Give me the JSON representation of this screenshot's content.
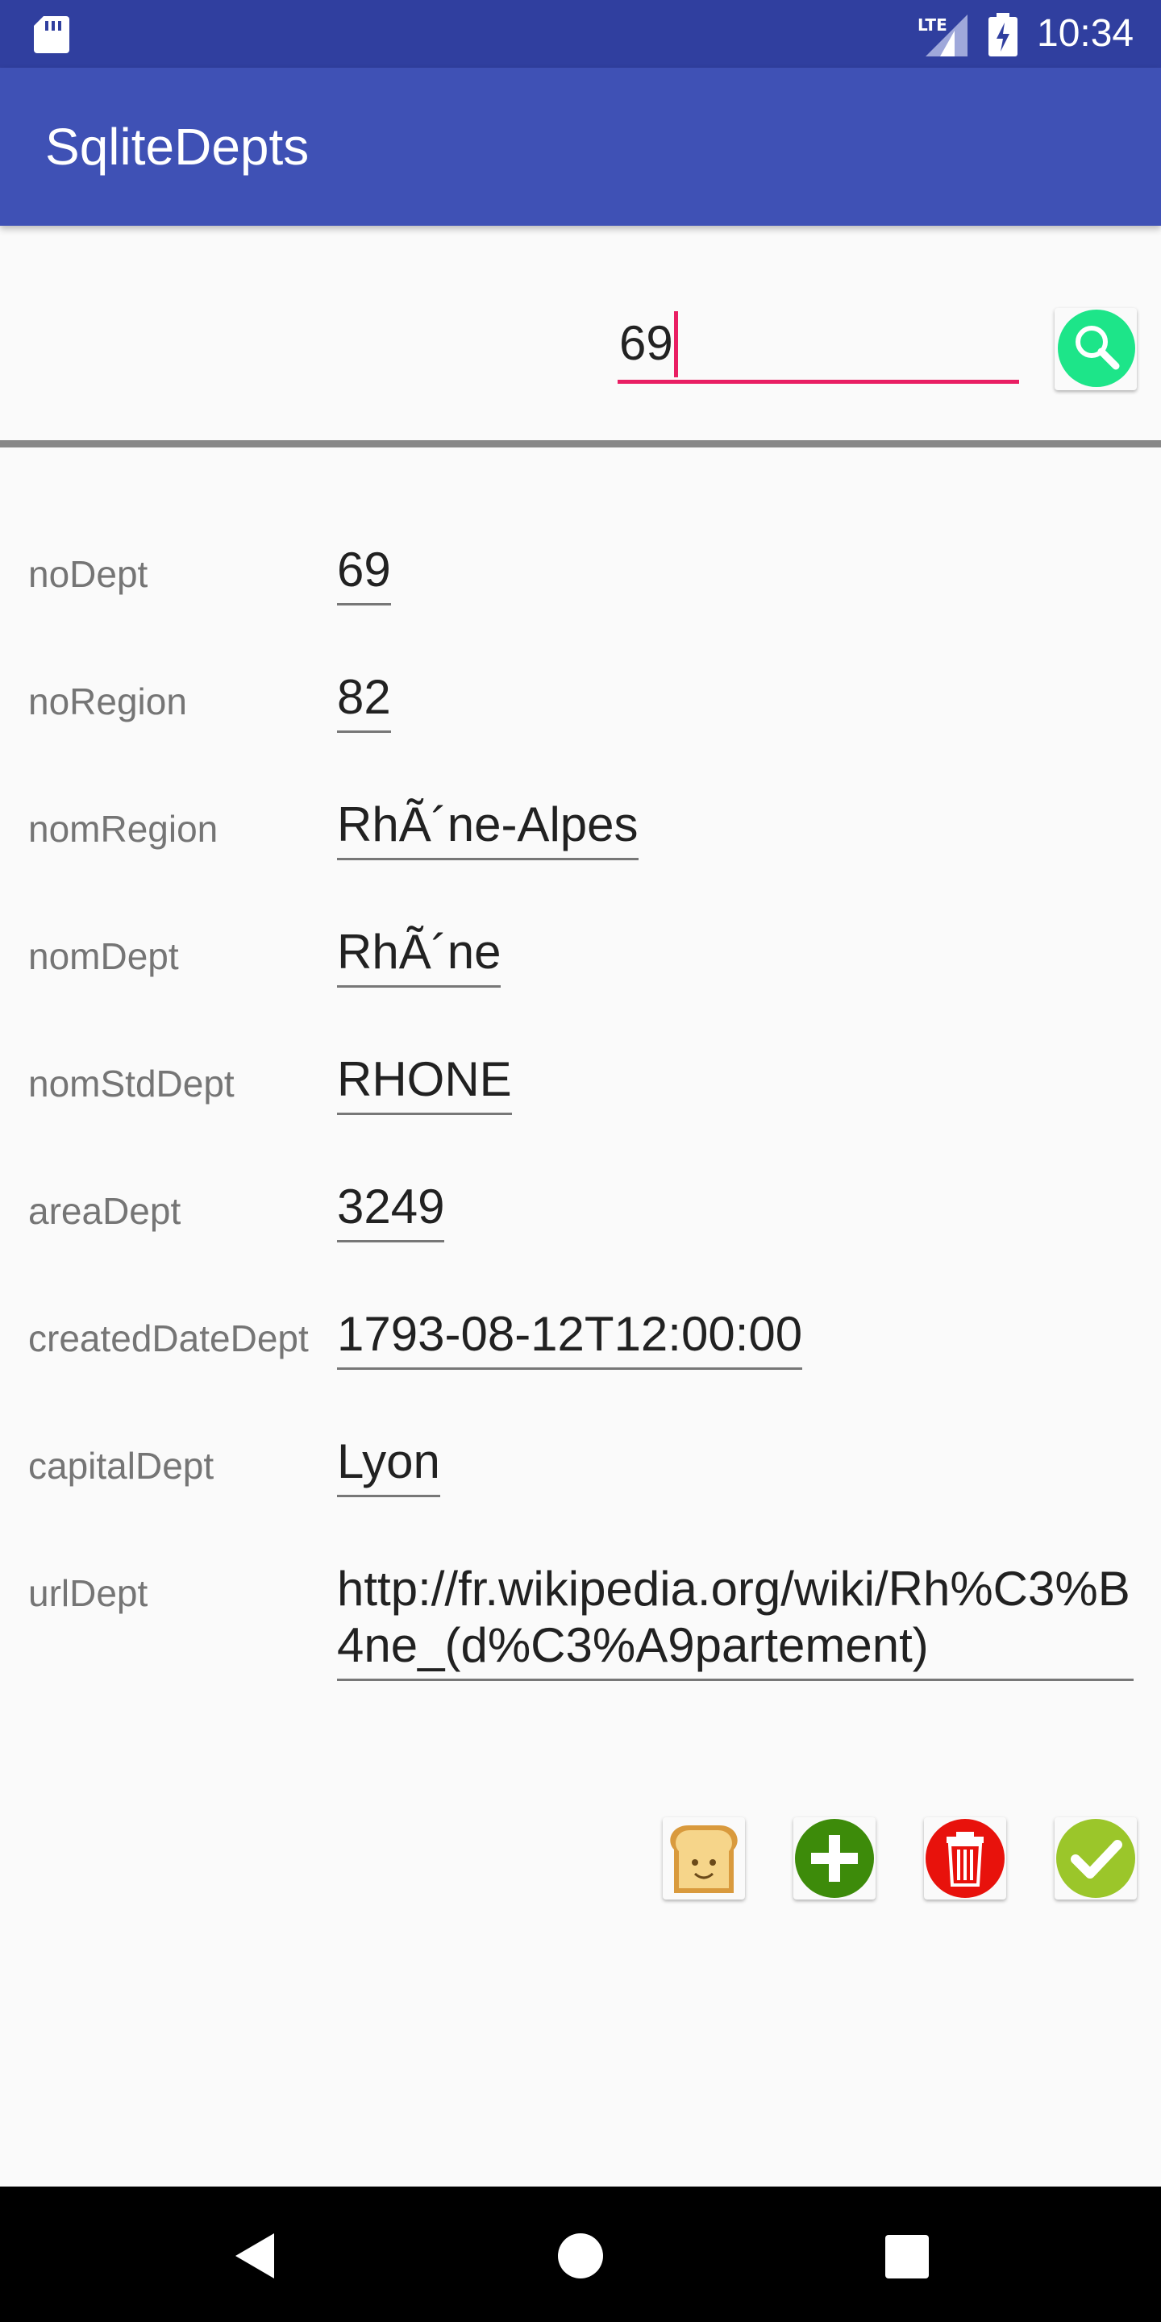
{
  "status_bar": {
    "network": "LTE",
    "time": "10:34"
  },
  "app_bar": {
    "title": "SqliteDepts"
  },
  "search": {
    "value": "69",
    "button_icon": "search-icon"
  },
  "form": {
    "rows": [
      {
        "label": "noDept",
        "value": "69"
      },
      {
        "label": "noRegion",
        "value": "82"
      },
      {
        "label": "nomRegion",
        "value": "RhÃ´ne-Alpes"
      },
      {
        "label": "nomDept",
        "value": "RhÃ´ne"
      },
      {
        "label": "nomStdDept",
        "value": "RHONE"
      },
      {
        "label": "areaDept",
        "value": "3249"
      },
      {
        "label": "createdDateDept",
        "value": "1793-08-12T12:00:00"
      },
      {
        "label": "capitalDept",
        "value": "Lyon"
      },
      {
        "label": "urlDept",
        "value": "http://fr.wikipedia.org/wiki/Rh%C3%B4ne_(d%C3%A9partement)"
      }
    ]
  },
  "actions": [
    {
      "name": "toast-button",
      "icon": "toast-icon"
    },
    {
      "name": "add-button",
      "icon": "plus-icon"
    },
    {
      "name": "delete-button",
      "icon": "trash-icon"
    },
    {
      "name": "validate-button",
      "icon": "check-icon"
    }
  ],
  "colors": {
    "status_bar": "#303f9f",
    "app_bar": "#3f51b5",
    "input_underline": "#e91e63",
    "search_green": "#1de589",
    "add_green": "#3d8b0a",
    "delete_red": "#e8120c",
    "check_green": "#9bc62a"
  }
}
